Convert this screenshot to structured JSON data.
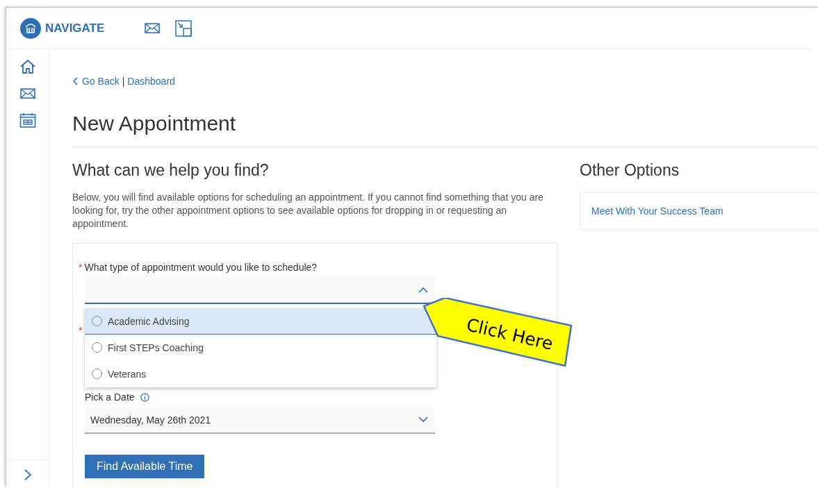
{
  "brand": {
    "name": "NAVIGATE"
  },
  "breadcrumb": {
    "back": "Go Back",
    "separator": "|",
    "current": "Dashboard"
  },
  "page_title": "New Appointment",
  "main": {
    "heading": "What can we help you find?",
    "description": "Below, you will find available options for scheduling an appointment. If you cannot find something that you are looking for, try the other appointment options to see available options for dropping in or requesting an appointment.",
    "form": {
      "type_field": {
        "required_mark": "*",
        "label": "What type of appointment would you like to schedule?",
        "expanded": true,
        "options": [
          {
            "label": "Academic Advising",
            "selected": true
          },
          {
            "label": "First STEPs Coaching",
            "selected": false
          },
          {
            "label": "Veterans",
            "selected": false
          }
        ]
      },
      "hidden_field": {
        "required_mark": "*"
      },
      "date_field": {
        "label": "Pick a Date",
        "value": "Wednesday, May 26th 2021"
      },
      "submit": "Find Available Time"
    }
  },
  "other_options": {
    "heading": "Other Options",
    "links": [
      "Meet With Your Success Team"
    ]
  },
  "callout": {
    "text": "Click Here"
  }
}
